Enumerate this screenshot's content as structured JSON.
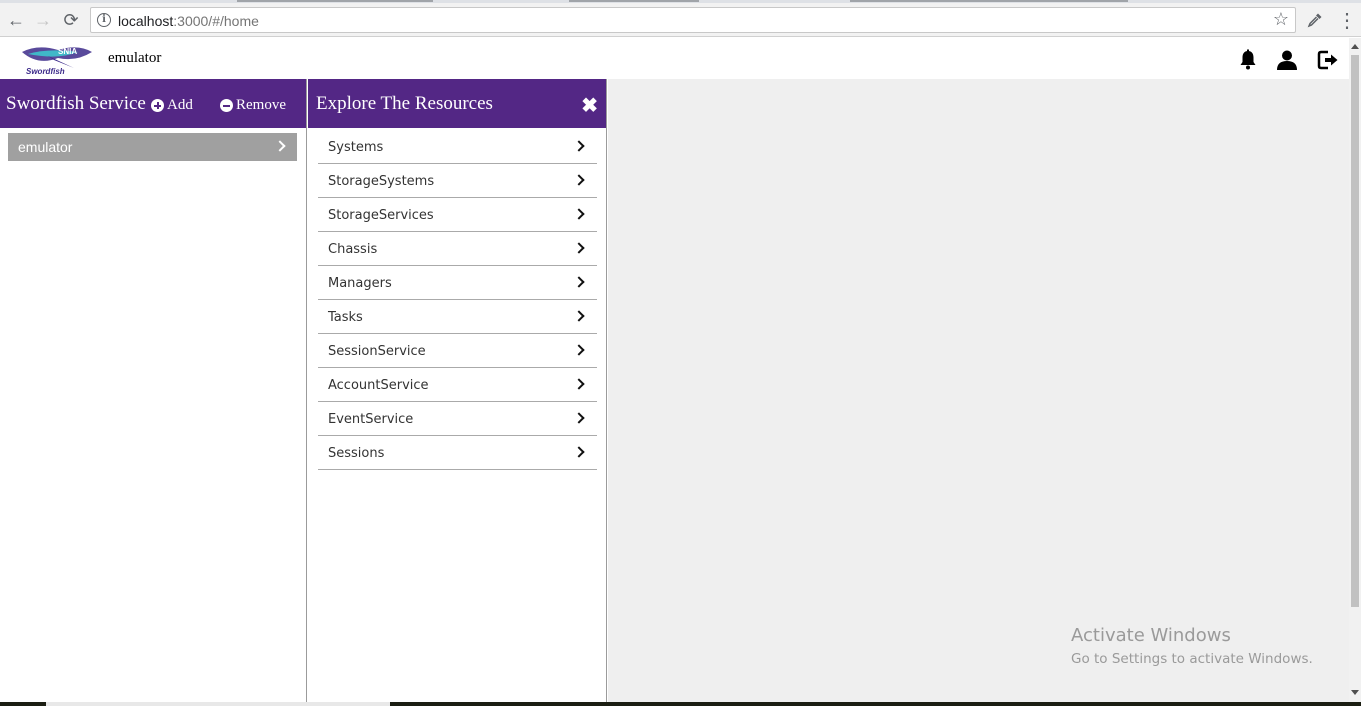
{
  "browser": {
    "url_host": "localhost",
    "url_rest": ":3000/#/home",
    "back_icon": "←",
    "forward_icon": "→",
    "reload_icon": "⟳",
    "star_icon": "☆",
    "menu_icon": "⋮"
  },
  "header": {
    "app_name": "emulator",
    "logo_text_top": "SNIA",
    "logo_text_bottom": "Swordfish"
  },
  "left_panel": {
    "title": "Swordfish Service",
    "add_label": "Add",
    "remove_label": "Remove",
    "services": [
      {
        "label": "emulator"
      }
    ]
  },
  "mid_panel": {
    "title": "Explore The Resources",
    "close_icon": "✖",
    "resources": [
      {
        "label": "Systems"
      },
      {
        "label": "StorageSystems"
      },
      {
        "label": "StorageServices"
      },
      {
        "label": "Chassis"
      },
      {
        "label": "Managers"
      },
      {
        "label": "Tasks"
      },
      {
        "label": "SessionService"
      },
      {
        "label": "AccountService"
      },
      {
        "label": "EventService"
      },
      {
        "label": "Sessions"
      }
    ]
  },
  "watermark": {
    "line1": "Activate Windows",
    "line2": "Go to Settings to activate Windows."
  },
  "colors": {
    "accent": "#532785",
    "selected_item": "#a0a0a0",
    "content_bg": "#efefef"
  }
}
